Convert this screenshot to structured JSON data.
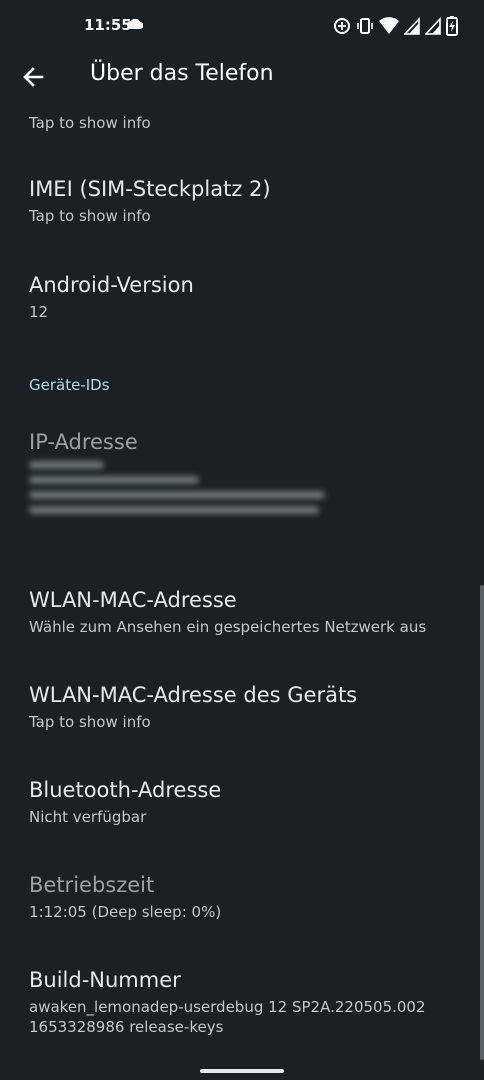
{
  "status": {
    "time": "11:55",
    "icons": [
      "cloud-icon",
      "data-saver-icon",
      "vibrate-icon",
      "wifi-icon",
      "signal-icon",
      "signal-icon-2",
      "battery-charging-icon"
    ]
  },
  "appbar": {
    "title": "Über das Telefon"
  },
  "items": [
    {
      "title": "",
      "subtitle": "Tap to show info"
    },
    {
      "title": "IMEI (SIM-Steckplatz 2)",
      "subtitle": "Tap to show info"
    },
    {
      "title": "Android-Version",
      "subtitle": "12"
    },
    {
      "title": "IP-Adresse",
      "subtitle": ""
    },
    {
      "title": "WLAN-MAC-Adresse",
      "subtitle": "Wähle zum Ansehen ein gespeichertes Netzwerk aus"
    },
    {
      "title": "WLAN-MAC-Adresse des Geräts",
      "subtitle": "Tap to show info"
    },
    {
      "title": "Bluetooth-Adresse",
      "subtitle": "Nicht verfügbar"
    },
    {
      "title": "Betriebszeit",
      "subtitle": "1:12:05 (Deep sleep: 0%)"
    },
    {
      "title": "Build-Nummer",
      "subtitle": "awaken_lemonadep-userdebug 12 SP2A.220505.002 1653328986 release-keys"
    }
  ],
  "section_header": "Geräte-IDs"
}
